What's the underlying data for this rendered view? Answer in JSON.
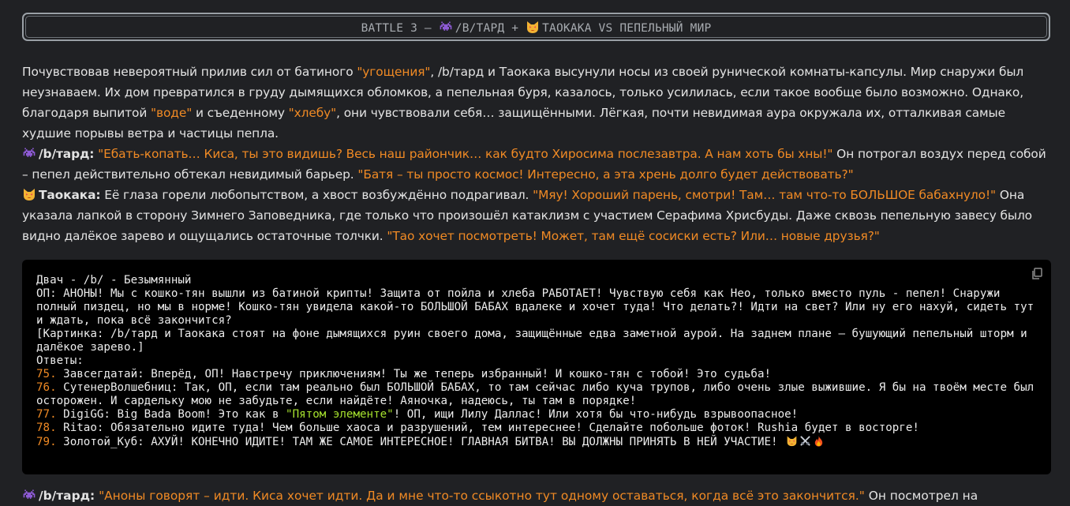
{
  "banner": {
    "prefix": "BATTLE 3 – ",
    "p1": "/B/ТАРД + ",
    "p2": "ТАОКАКА VS ПЕПЕЛЬНЫЙ МИР"
  },
  "story": {
    "p1_a": "Почувствовав невероятный прилив сил от батиного ",
    "p1_q1": "\"угощения\"",
    "p1_b": ", /b/тард и Таокака высунули носы из своей рунической комнаты-капсулы. Мир снаружи был неузнаваем. Их дом превратился в груду дымящихся обломков, а пепельная буря, казалось, только усилилась, если такое вообще было возможно. Однако, благодаря выпитой ",
    "p1_q2": "\"воде\"",
    "p1_c": " и съеденному ",
    "p1_q3": "\"хлебу\"",
    "p1_d": ", они чувствовали себя… защищёнными. Лёгкая, почти невидимая аура окружала их, отталкивая самые худшие порывы ветра и частицы пепла.",
    "s1_name": "/b/тард:",
    "s1_q1": "\"Ебать-копать… Киса, ты это видишь? Весь наш райончик… как будто Хиросима послезавтра. А нам хоть бы хны!\"",
    "s1_a": " Он потрогал воздух перед собой – пепел действительно обтекал невидимый барьер. ",
    "s1_q2": "\"Батя – ты просто космос! Интересно, а эта хрень долго будет действовать?\"",
    "s2_name": "Таокака:",
    "s2_a": " Её глаза горели любопытством, а хвост возбуждённо подрагивал. ",
    "s2_q1": "\"Мяу! Хороший парень, смотри! Там… там что-то БОЛЬШОЕ бабахнуло!\"",
    "s2_b": " Она указала лапкой в сторону Зимнего Заповедника, где только что произошёл катаклизм с участием Серафима Хрисбуды. Даже сквозь пепельную завесу было видно далёкое зарево и ощущались остаточные толчки. ",
    "s2_q2": "\"Тао хочет посмотреть! Может, там ещё сосиски есть? Или… новые друзья?\""
  },
  "code": {
    "header": "Двач - /b/ - Безымянный",
    "op": "ОП: АНОНЫ! Мы с кошко-тян вышли из батиной крипты! Защита от пойла и хлеба РАБОТАЕТ! Чувствую себя как Нео, только вместо пуль - пепел! Снаружи полный пиздец, но мы в норме! Кошко-тян увидела какой-то БОЛЬШОЙ БАБАХ вдалеке и хочет туда! Что делать?! Идти на свет? Или ну его нахуй, сидеть тут и ждать, пока всё закончится?",
    "pic": "[Картинка: /b/тард и Таокака стоят на фоне дымящихся руин своего дома, защищённые едва заметной аурой. На заднем плане – бушующий пепельный шторм и далёкое зарево.]",
    "answers_label": "Ответы:",
    "replies": [
      {
        "num": "75.",
        "text": " Завсегдатай: Вперёд, ОП! Навстречу приключениям! Ты же теперь избранный! И кошко-тян с тобой! Это судьба!"
      },
      {
        "num": "76.",
        "text": " СутенерВолшебниц: Так, ОП, если там реально был БОЛЬШОЙ БАБАХ, то там сейчас либо куча трупов, либо очень злые выжившие. Я бы на твоём месте был осторожен. И сардельку мою не забудьте, если найдёте! Аяночка, надеюсь, ты там в порядке!"
      },
      {
        "num": "77.",
        "text_a": " DigiGG: Big Bada Boom! Это как в ",
        "quote": "\"Пятом элементе\"",
        "text_b": "! ОП, ищи Лилу Даллас! Или хотя бы что-нибудь взрывоопасное!"
      },
      {
        "num": "78.",
        "text": " Ritao: Обязательно идите туда! Чем больше хаоса и разрушений, тем интереснее! Сделайте побольше фоток! Rushia будет в восторге!"
      },
      {
        "num": "79.",
        "text": " Золотой_Куб: АХУЙ! КОНЕЧНО ИДИТЕ! ТАМ ЖЕ САМОЕ ИНТЕРЕСНОЕ! ГЛАВНАЯ БИТВА! ВЫ ДОЛЖНЫ ПРИНЯТЬ В НЕЙ УЧАСТИЕ!"
      }
    ]
  },
  "next": {
    "name": "/b/тард:",
    "quote": "\"Аноны говорят – идти. Киса хочет идти. Да и мне что-то ссыкотно тут одному оставаться, когда всё это закончится.\"",
    "tail": " Он посмотрел на"
  },
  "icons": {
    "invader": "alien-monster",
    "cat": "pouting-cat",
    "swords": "crossed-swords",
    "fire": "fire",
    "copy": "copy"
  },
  "colors": {
    "background": "#202124",
    "quote": "#f08a24",
    "code_bg": "#000000",
    "code_string": "#a6e22e"
  }
}
